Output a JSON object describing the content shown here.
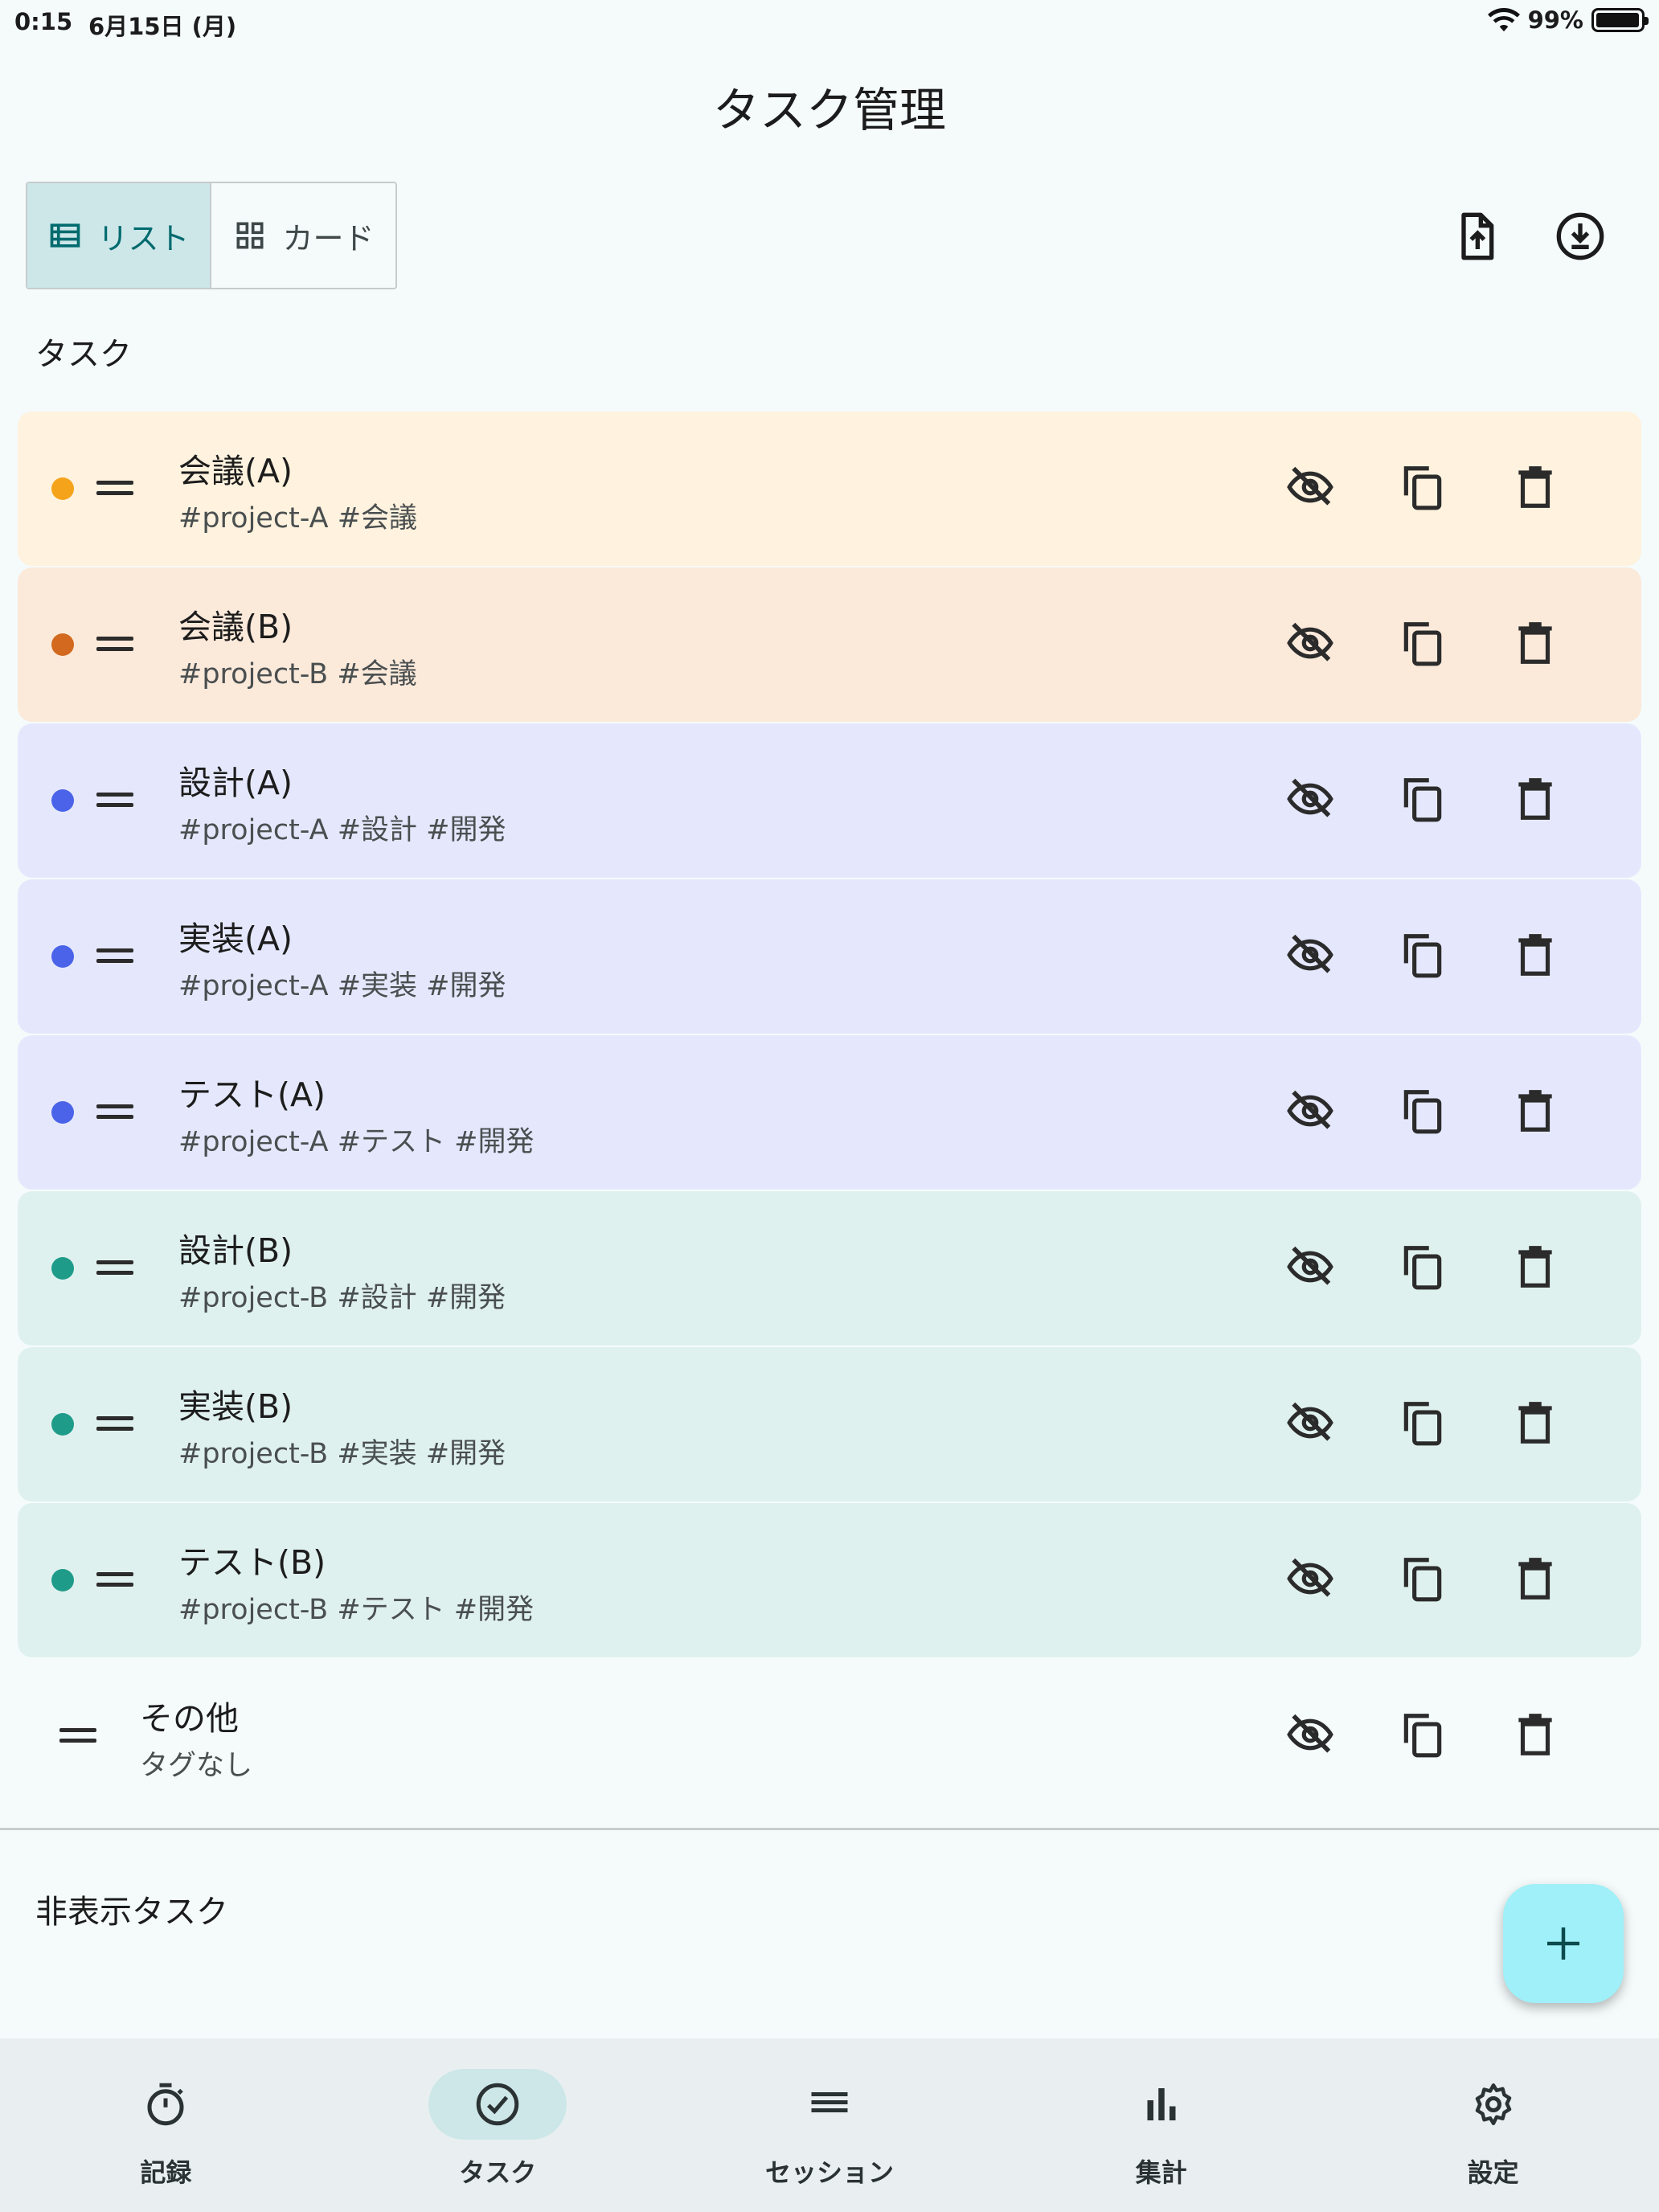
{
  "status_bar": {
    "time": "0:15",
    "date": "6月15日 (月)",
    "battery": "99%",
    "battery_level": 0.99
  },
  "header": {
    "title": "タスク管理"
  },
  "view_toggle": {
    "list_label": "リスト",
    "card_label": "カード",
    "selected": "list"
  },
  "header_actions": {
    "export_icon": "file-upload-icon",
    "import_icon": "download-circle-icon"
  },
  "tasks_section": {
    "title": "タスク",
    "items": [
      {
        "name": "会議(A)",
        "tags": "#project-A #会議",
        "dot_color": "#f5a31a",
        "bg_color": "#fff2de"
      },
      {
        "name": "会議(B)",
        "tags": "#project-B #会議",
        "dot_color": "#d2691e",
        "bg_color": "#fbe9da"
      },
      {
        "name": "設計(A)",
        "tags": "#project-A #設計 #開発",
        "dot_color": "#4a63e8",
        "bg_color": "#e5e8fd"
      },
      {
        "name": "実装(A)",
        "tags": "#project-A #実装 #開発",
        "dot_color": "#4a63e8",
        "bg_color": "#e5e8fd"
      },
      {
        "name": "テスト(A)",
        "tags": "#project-A #テスト #開発",
        "dot_color": "#4a63e8",
        "bg_color": "#e5e8fd"
      },
      {
        "name": "設計(B)",
        "tags": "#project-B #設計 #開発",
        "dot_color": "#1f9b8a",
        "bg_color": "#dff1ee"
      },
      {
        "name": "実装(B)",
        "tags": "#project-B #実装 #開発",
        "dot_color": "#1f9b8a",
        "bg_color": "#dff1ee"
      },
      {
        "name": "テスト(B)",
        "tags": "#project-B #テスト #開発",
        "dot_color": "#1f9b8a",
        "bg_color": "#dff1ee"
      }
    ],
    "other": {
      "name": "その他",
      "tags": "タグなし"
    }
  },
  "hidden_section": {
    "title": "非表示タスク"
  },
  "fab": {
    "icon": "plus-icon"
  },
  "bottom_nav": {
    "items": [
      {
        "label": "記録",
        "icon": "stopwatch-icon"
      },
      {
        "label": "タスク",
        "icon": "check-circle-icon"
      },
      {
        "label": "セッション",
        "icon": "list-lines-icon"
      },
      {
        "label": "集計",
        "icon": "bar-chart-icon"
      },
      {
        "label": "設定",
        "icon": "gear-icon"
      }
    ],
    "active_index": 1
  },
  "colors": {
    "accent": "#006a6e",
    "background": "#f5fbfb",
    "fab": "#9ff0f8",
    "nav_background": "#e9eff0"
  }
}
